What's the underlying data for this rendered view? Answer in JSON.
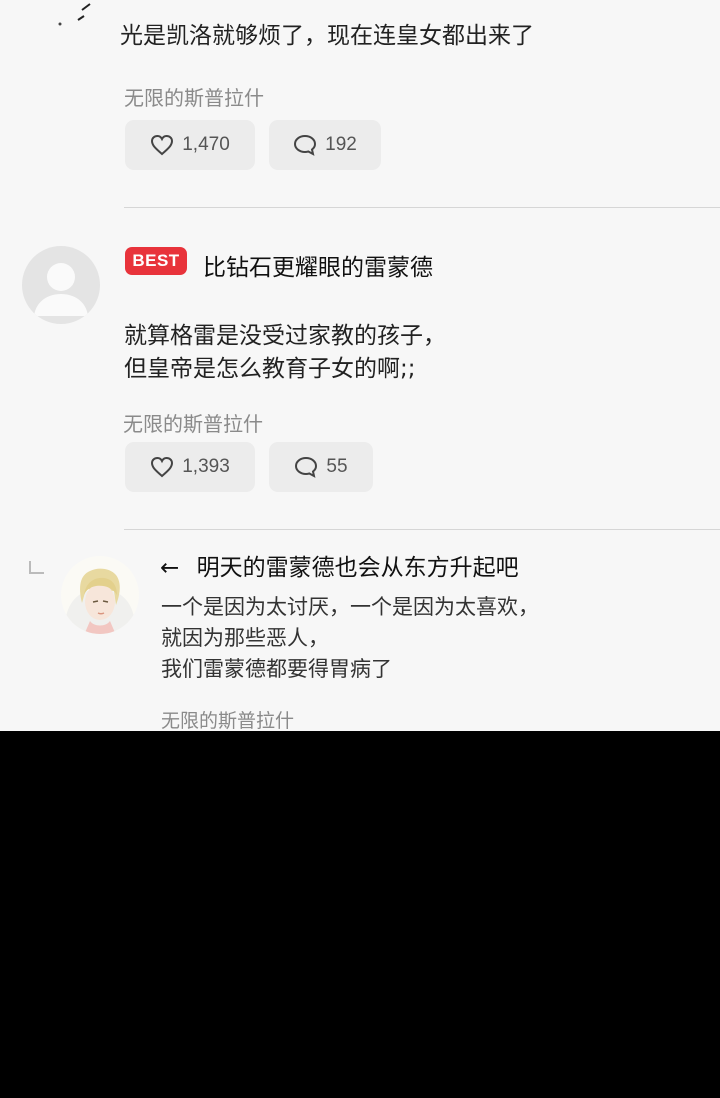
{
  "comment_1": {
    "text": "光是凯洛就够烦了，现在连皇女都出来了",
    "source": "无限的斯普拉什",
    "likes": "1,470",
    "replies": "192"
  },
  "comment_2": {
    "badge": "BEST",
    "nickname": "比钻石更耀眼的雷蒙德",
    "text_lines": [
      "就算格雷是没受过家教的孩子，",
      "但皇帝是怎么教育子女的啊;;"
    ],
    "source": "无限的斯普拉什",
    "likes": "1,393",
    "replies": "55"
  },
  "reply_1": {
    "reply_arrow": "←",
    "nickname": "明天的雷蒙德也会从东方升起吧",
    "text_lines": [
      "一个是因为太讨厌，一个是因为太喜欢，",
      "就因为那些恶人，",
      "我们雷蒙德都要得胃病了"
    ],
    "source": "无限的斯普拉什"
  },
  "colors": {
    "best_badge": "#e8333b",
    "panel_bg": "#f7f7f7",
    "pill_bg": "#ececec"
  },
  "icons": [
    "heart-icon",
    "speech-bubble-icon",
    "reply-corner-icon",
    "default-avatar-icon",
    "illustrated-avatar"
  ]
}
